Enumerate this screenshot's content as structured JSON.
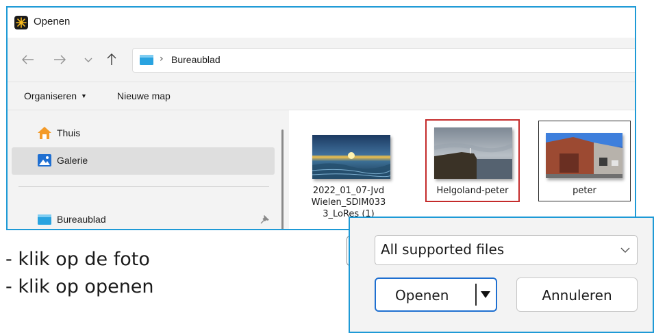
{
  "window": {
    "title": "Openen"
  },
  "navigation": {
    "back_icon": "arrow-left-icon",
    "forward_icon": "arrow-right-icon",
    "recent_icon": "chevron-down-icon",
    "up_icon": "arrow-up-icon",
    "breadcrumb": [
      "Bureaublad"
    ]
  },
  "commands": {
    "organize": "Organiseren",
    "new_folder": "Nieuwe map"
  },
  "sidebar": {
    "items": [
      {
        "label": "Thuis",
        "icon": "home-icon",
        "selected": false
      },
      {
        "label": "Galerie",
        "icon": "gallery-icon",
        "selected": true
      },
      {
        "label": "Bureaublad",
        "icon": "desktop-folder-icon",
        "selected": false,
        "pinned": true
      }
    ]
  },
  "files": [
    {
      "name": "2022_01_07-Jvd Wielen_SDIM0333_LoRes (1)",
      "name_lines": [
        "2022_01_07-Jvd",
        "Wielen_SDIM033",
        "3_LoRes (1)"
      ],
      "selected": false
    },
    {
      "name": "Helgoland-peter",
      "name_lines": [
        "Helgoland-peter"
      ],
      "selected": true
    },
    {
      "name": "peter",
      "name_lines": [
        "peter"
      ],
      "selected": false
    }
  ],
  "instructions": [
    "- klik op de foto",
    "- klik op openen"
  ],
  "footer": {
    "file_type_filter": "All supported files",
    "open_button": "Openen",
    "cancel_button": "Annuleren"
  },
  "colors": {
    "highlight_border": "#1e9ad6",
    "selection_border": "#c42b2b",
    "primary_button_border": "#1e6fd0"
  }
}
